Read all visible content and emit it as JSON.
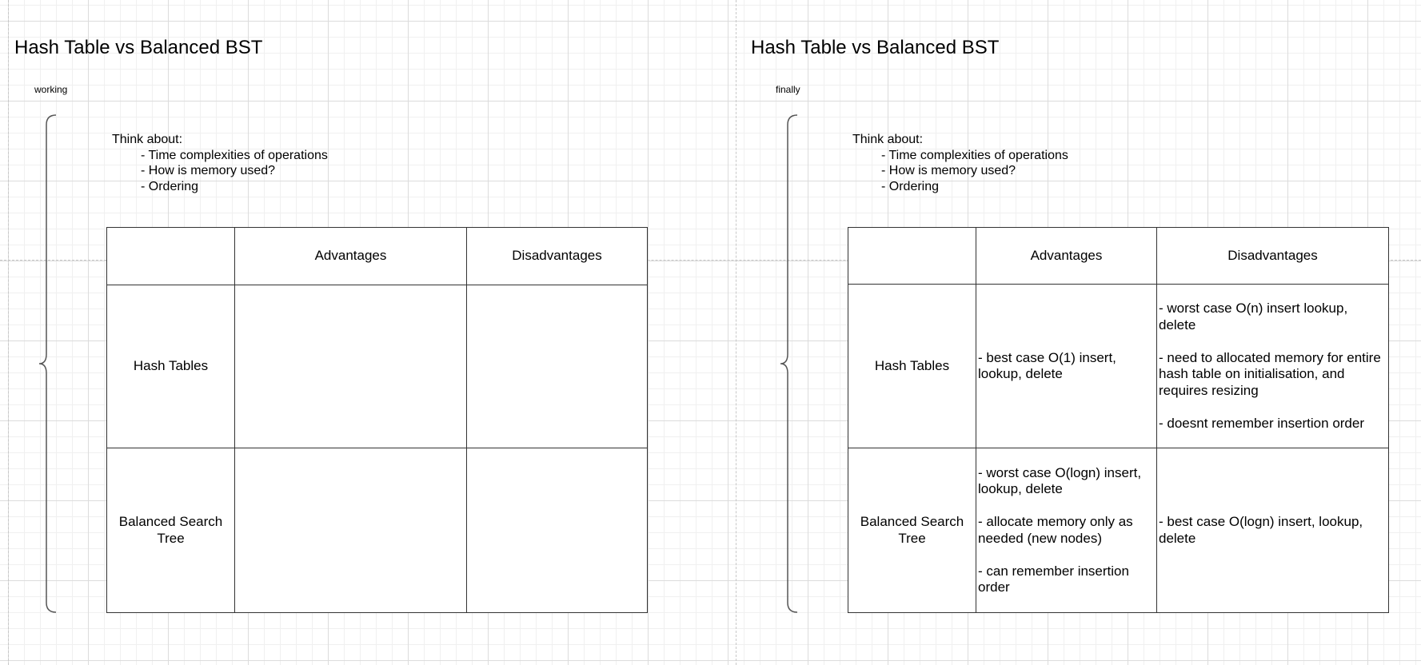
{
  "panels": [
    {
      "title": "Hash Table vs Balanced BST",
      "status": "working",
      "think": {
        "heading": "Think about:",
        "items": [
          "- Time complexities of operations",
          "- How is memory used?",
          "- Ordering"
        ]
      },
      "table": {
        "headers": [
          "",
          "Advantages",
          "Disadvantages"
        ],
        "rows": [
          {
            "label": "Hash Tables",
            "advantages": [],
            "disadvantages": []
          },
          {
            "label": "Balanced Search Tree",
            "advantages": [],
            "disadvantages": []
          }
        ]
      }
    },
    {
      "title": "Hash Table vs Balanced BST",
      "status": "finally",
      "think": {
        "heading": "Think about:",
        "items": [
          "- Time complexities of operations",
          "- How is memory used?",
          "- Ordering"
        ]
      },
      "table": {
        "headers": [
          "",
          "Advantages",
          "Disadvantages"
        ],
        "rows": [
          {
            "label": "Hash Tables",
            "advantages": [
              "- best case O(1) insert, lookup, delete"
            ],
            "disadvantages": [
              "- worst case O(n) insert lookup, delete",
              "- need to allocated memory for entire hash table on initialisation, and requires resizing",
              "- doesnt remember insertion order"
            ]
          },
          {
            "label": "Balanced Search Tree",
            "advantages": [
              "- worst case O(logn) insert, lookup, delete",
              "- allocate memory only as needed (new nodes)",
              "- can remember insertion order"
            ],
            "disadvantages": [
              "- best case O(logn) insert, lookup, delete"
            ]
          }
        ]
      }
    }
  ]
}
